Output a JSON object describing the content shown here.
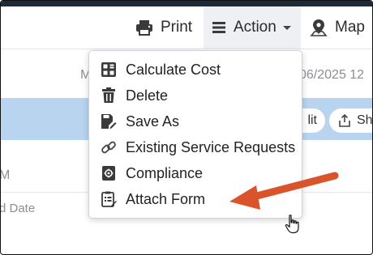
{
  "toolbar": {
    "print_label": "Print",
    "action_label": "Action",
    "map_label": "Map"
  },
  "background": {
    "meta_letter": "M",
    "meta_date": "06/2025 12",
    "row_letter": "M",
    "field_label": "d Date",
    "edit_partial": "lit",
    "share_partial": "Sh"
  },
  "action_menu": {
    "items": [
      {
        "label": "Calculate Cost",
        "icon": "calculator-icon"
      },
      {
        "label": "Delete",
        "icon": "trash-icon"
      },
      {
        "label": "Save As",
        "icon": "save-as-icon"
      },
      {
        "label": "Existing Service Requests",
        "icon": "link-icon"
      },
      {
        "label": "Compliance",
        "icon": "compliance-icon"
      },
      {
        "label": "Attach Form",
        "icon": "form-icon"
      }
    ]
  },
  "colors": {
    "toolbar_active_bg": "#eef0f3",
    "band_bg": "#b9d4ef",
    "annotation_arrow": "#d9532b"
  }
}
